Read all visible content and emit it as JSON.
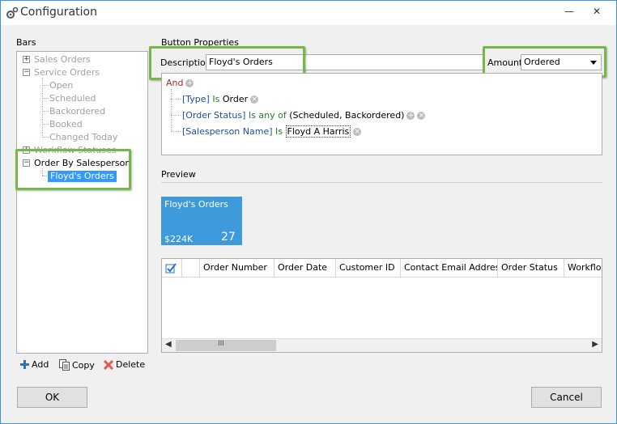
{
  "window": {
    "title": "Configuration",
    "minimize_glyph": "—",
    "close_glyph": "✕",
    "icon": "gear-icon"
  },
  "bars": {
    "label": "Bars",
    "tree": {
      "sales_orders": "Sales Orders",
      "service_orders": "Service Orders",
      "open": "Open",
      "scheduled": "Scheduled",
      "backordered": "Backordered",
      "booked": "Booked",
      "changed_today": "Changed Today",
      "workflow_statuses": "Workflow Statuses",
      "order_by_salesperson": "Order By Salesperson",
      "floyds_orders": "Floyd's Orders"
    },
    "add": "Add",
    "copy": "Copy",
    "delete": "Delete"
  },
  "button_properties": {
    "label": "Button Properties",
    "description_label": "Description",
    "description_value": "Floyd's Orders",
    "amount_label": "Amount",
    "amount_value": "Ordered"
  },
  "filter": {
    "and": "And",
    "line1_field": "[Type]",
    "line1_op": "Is",
    "line1_val": "Order",
    "line2_field": "[Order Status]",
    "line2_op": "Is any of",
    "line2_val": "(Scheduled, Backordered)",
    "line3_field": "[Salesperson Name]",
    "line3_op": "Is",
    "line3_val": "Floyd A Harris"
  },
  "preview": {
    "label": "Preview",
    "tile_title": "Floyd's Orders",
    "tile_amount": "$224K",
    "tile_count": "27",
    "tile_color": "#3f9adb"
  },
  "grid": {
    "columns": [
      "Order Number",
      "Order Date",
      "Customer ID",
      "Contact Email Address",
      "Order Status",
      "Workflow"
    ],
    "scroll_glyph": "III"
  },
  "footer": {
    "ok": "OK",
    "cancel": "Cancel"
  },
  "colors": {
    "highlight": "#77b74a",
    "selection": "#3399ff"
  }
}
